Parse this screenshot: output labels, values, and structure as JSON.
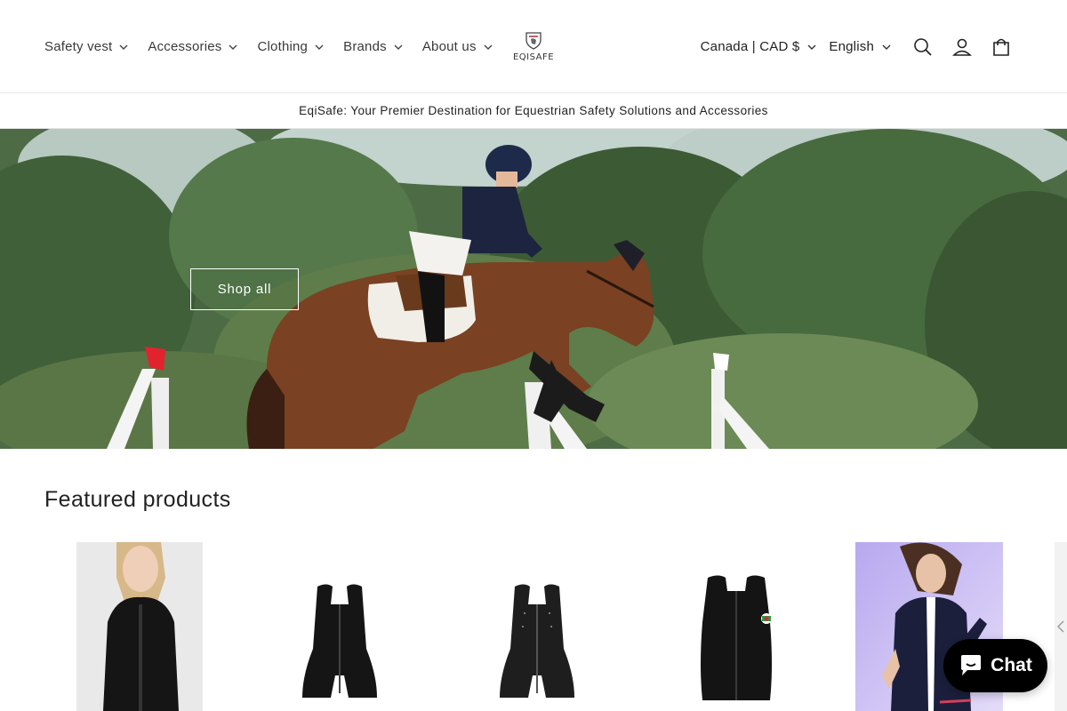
{
  "header": {
    "nav": [
      {
        "label": "Safety vest"
      },
      {
        "label": "Accessories"
      },
      {
        "label": "Clothing"
      },
      {
        "label": "Brands"
      },
      {
        "label": "About us"
      }
    ],
    "logo_text": "EQISAFE",
    "country_label": "Canada | CAD $",
    "language_label": "English",
    "icons": [
      "search-icon",
      "account-icon",
      "cart-icon",
      "chevron-down-icon"
    ]
  },
  "announcement": {
    "text": "EqiSafe: Your Premier Destination for Equestrian Safety Solutions and Accessories"
  },
  "hero": {
    "button_label": "Shop all"
  },
  "featured": {
    "title": "Featured products",
    "products": [
      {
        "image": "woman-in-black-airbag-vest-photo"
      },
      {
        "image": "black-airbag-vest-product"
      },
      {
        "image": "black-airbag-vest-product-studded"
      },
      {
        "image": "black-vest-with-flag-patch"
      },
      {
        "image": "woman-in-navy-show-jacket-photo"
      }
    ]
  },
  "chat": {
    "label": "Chat"
  },
  "colors": {
    "text": "#121212",
    "border": "#e6e6e6",
    "chat_bg": "#000000",
    "flag_red": "#e2232e"
  }
}
